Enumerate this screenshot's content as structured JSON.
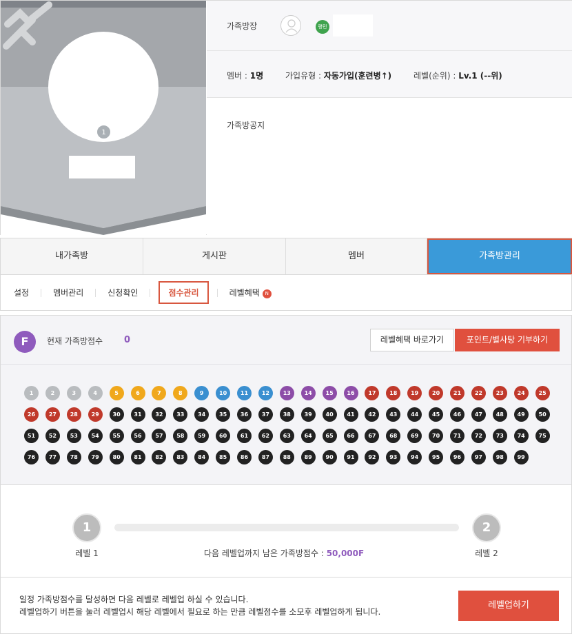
{
  "owner": {
    "label": "가족방장",
    "badge": "평민"
  },
  "stats": {
    "member_label": "멤버 :",
    "member_value": "1명",
    "join_label": "가입유형 :",
    "join_value": "자동가입(훈련병↑)",
    "level_label": "레벨(순위) :",
    "level_value": "Lv.1 (--위)"
  },
  "notice": {
    "label": "가족방공지"
  },
  "banner": {
    "level_badge": "1"
  },
  "tabs": [
    "내가족방",
    "게시판",
    "멤버",
    "가족방관리"
  ],
  "subnav": {
    "items": [
      "설정",
      "멤버관리",
      "신청확인",
      "점수관리",
      "레벨혜택"
    ],
    "new_badge": "N"
  },
  "score": {
    "icon": "F",
    "label": "현재 가족방점수",
    "value": "0",
    "btn_benefit": "레벨혜택 바로가기",
    "btn_donate": "포인트/별사탕 기부하기"
  },
  "levels": {
    "count": 99,
    "colors": {
      "gray": "#b9bcbf",
      "orange": "#f0a81c",
      "blue": "#3a8fd0",
      "purple": "#8d4da8",
      "red": "#c0392b",
      "black": "#222222"
    }
  },
  "progress": {
    "current_level": "1",
    "next_level": "2",
    "current_caption": "레벨 1",
    "next_caption": "레벨 2",
    "remain_label": "다음 레벨업까지 남은 가족방점수 :",
    "remain_value": "50,000F",
    "fill_fraction": 0
  },
  "footer": {
    "line1": "일정 가족방점수를 달성하면 다음 레벨로 레벨업 하실 수 있습니다.",
    "line2": "레벨업하기 버튼을 눌러 레벨업시 해당 레벨에서 필요로 하는 만큼 레벨점수를 소모후 레벨업하게 됩니다.",
    "btn_levelup": "레벨업하기"
  }
}
